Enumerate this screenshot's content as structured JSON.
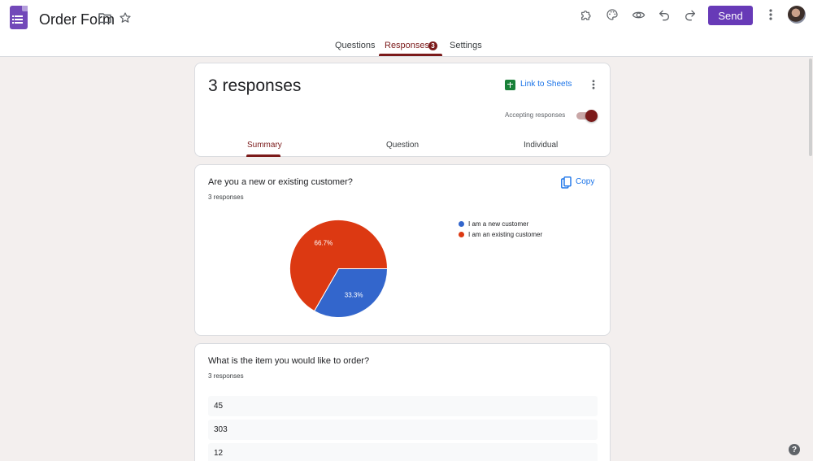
{
  "header": {
    "title": "Order Form",
    "send_label": "Send",
    "icons": [
      "forms-app-icon",
      "folder-icon",
      "star-icon",
      "addon-puzzle-icon",
      "palette-icon",
      "eye-preview-icon",
      "undo-icon",
      "redo-icon",
      "more-vert-icon",
      "avatar"
    ]
  },
  "tabs": [
    {
      "label": "Questions",
      "active": false
    },
    {
      "label": "Responses",
      "active": true,
      "badge": "3"
    },
    {
      "label": "Settings",
      "active": false
    }
  ],
  "summary_card": {
    "count_text": "3 responses",
    "link_sheets_label": "Link to Sheets",
    "accepting_label": "Accepting responses",
    "accepting": true,
    "subtabs": [
      {
        "label": "Summary",
        "active": true
      },
      {
        "label": "Question",
        "active": false
      },
      {
        "label": "Individual",
        "active": false
      }
    ]
  },
  "question1": {
    "title": "Are you a new or existing customer?",
    "responses_text": "3 responses",
    "copy_label": "Copy"
  },
  "question2": {
    "title": "What is the item you would like to order?",
    "responses_text": "3 responses",
    "answers": [
      "45",
      "303",
      "12"
    ]
  },
  "help_label": "?",
  "colors": {
    "accent": "#673ab7",
    "theme": "#7b1a1a",
    "link": "#1a73e8",
    "pie_new": "#3366cc",
    "pie_existing": "#dc3912"
  },
  "chart_data": {
    "type": "pie",
    "categories": [
      "I am a new customer",
      "I am an existing customer"
    ],
    "values": [
      33.3,
      66.7
    ],
    "labels": [
      "33.3%",
      "66.7%"
    ],
    "colors": [
      "#3366cc",
      "#dc3912"
    ],
    "legend": "right"
  }
}
